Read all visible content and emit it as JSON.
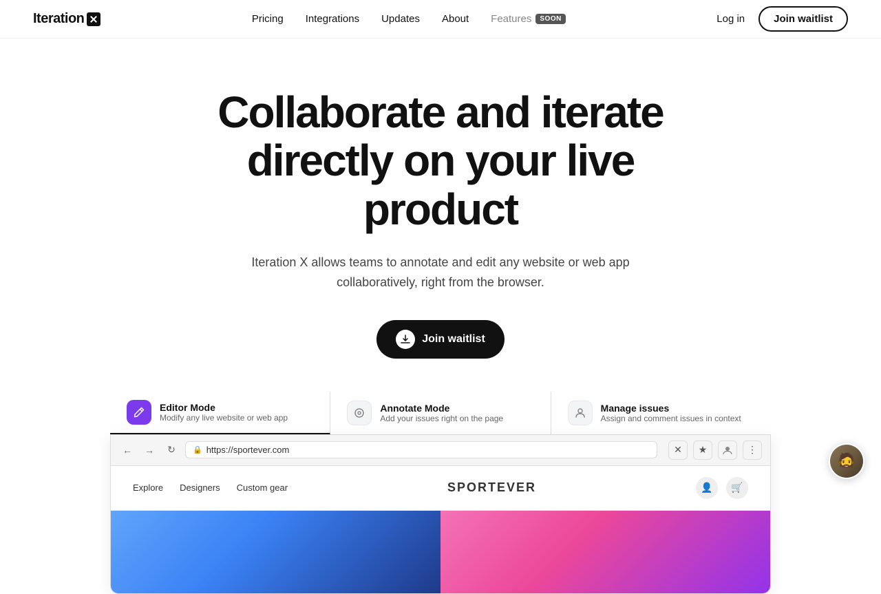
{
  "logo": {
    "text": "Iteration",
    "x_label": "X"
  },
  "nav": {
    "links": [
      {
        "label": "Pricing",
        "id": "pricing",
        "muted": false
      },
      {
        "label": "Integrations",
        "id": "integrations",
        "muted": false
      },
      {
        "label": "Updates",
        "id": "updates",
        "muted": false
      },
      {
        "label": "About",
        "id": "about",
        "muted": false
      },
      {
        "label": "Features",
        "id": "features",
        "muted": true
      }
    ],
    "soon_badge": "SOON",
    "login_label": "Log in",
    "join_label": "Join waitlist"
  },
  "hero": {
    "title": "Collaborate and iterate directly on your live product",
    "subtitle": "Iteration X allows teams to annotate and edit any website or web app collaboratively, right from the browser.",
    "cta_label": "Join waitlist"
  },
  "demo": {
    "tabs": [
      {
        "id": "editor",
        "title": "Editor Mode",
        "desc": "Modify any live website or web app",
        "icon_type": "purple",
        "active": true
      },
      {
        "id": "annotate",
        "title": "Annotate Mode",
        "desc": "Add your issues right on the page",
        "icon_type": "gray",
        "active": false
      },
      {
        "id": "manage",
        "title": "Manage issues",
        "desc": "Assign and comment issues in context",
        "icon_type": "gray",
        "active": false
      }
    ],
    "browser": {
      "url": "https://sportever.com",
      "nav_links": [
        "Explore",
        "Designers",
        "Custom gear"
      ],
      "logo": "SPORTEVER"
    }
  }
}
